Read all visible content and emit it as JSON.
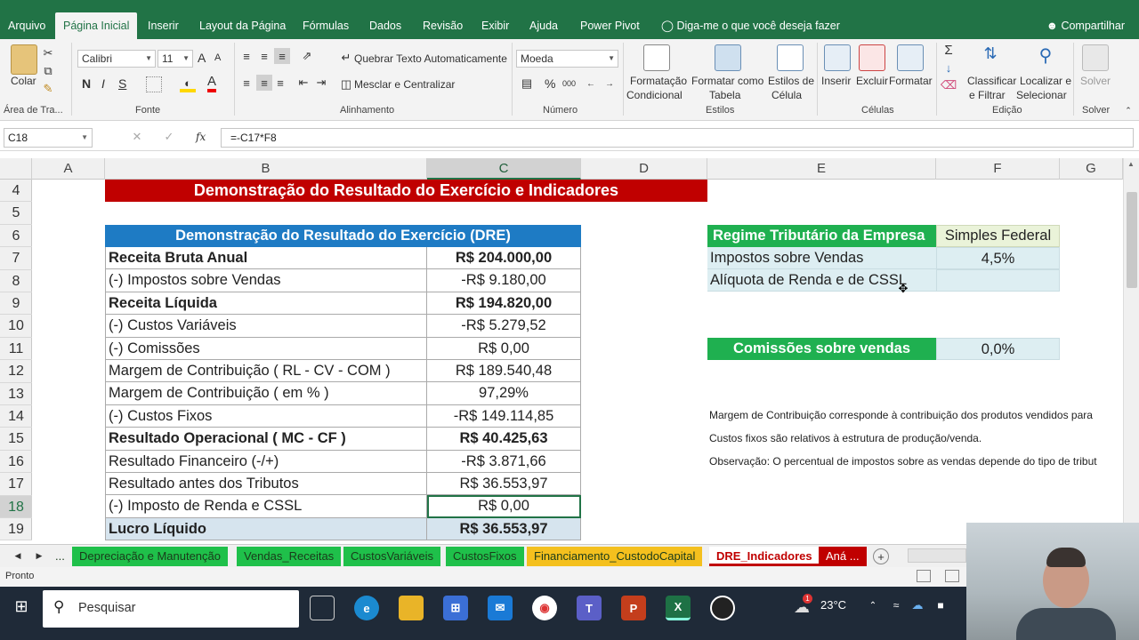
{
  "ribbon_tabs": [
    "Arquivo",
    "Página Inicial",
    "Inserir",
    "Layout da Página",
    "Fórmulas",
    "Dados",
    "Revisão",
    "Exibir",
    "Ajuda",
    "Power Pivot",
    "Diga-me o que você deseja fazer"
  ],
  "share_label": "Compartilhar",
  "ribbon": {
    "clipboard": {
      "paste": "Colar",
      "group": "Área de Tra..."
    },
    "font": {
      "name": "Calibri",
      "size": "11",
      "bold": "N",
      "italic": "I",
      "underline": "S",
      "grow": "A",
      "shrink": "A",
      "color": "A",
      "group": "Fonte"
    },
    "alignment": {
      "wrap": "Quebrar Texto Automaticamente",
      "merge": "Mesclar e Centralizar",
      "group": "Alinhamento"
    },
    "number": {
      "format": "Moeda",
      "percent": "%",
      "thousands": "000",
      "group": "Número"
    },
    "styles": {
      "cond1": "Formatação",
      "cond2": "Condicional",
      "table1": "Formatar como",
      "table2": "Tabela",
      "cell1": "Estilos de",
      "cell2": "Célula",
      "group": "Estilos"
    },
    "cells": {
      "insert": "Inserir",
      "delete": "Excluir",
      "format": "Formatar",
      "group": "Células"
    },
    "editing": {
      "sort1": "Classificar",
      "sort2": "e Filtrar",
      "find1": "Localizar e",
      "find2": "Selecionar",
      "group": "Edição"
    },
    "solver": {
      "label": "Solver",
      "group": "Solver"
    }
  },
  "formula_bar": {
    "name_box": "C18",
    "fx": "fx",
    "formula": "=-C17*F8"
  },
  "columns": [
    "A",
    "B",
    "C",
    "D",
    "E",
    "F",
    "G"
  ],
  "rows": [
    "4",
    "5",
    "6",
    "7",
    "8",
    "9",
    "10",
    "11",
    "12",
    "13",
    "14",
    "15",
    "16",
    "17",
    "18",
    "19"
  ],
  "sheet": {
    "main_title": "Demonstração do Resultado do Exercício e Indicadores",
    "dre_header": "Demonstração do Resultado do Exercício (DRE)",
    "dre_rows": [
      {
        "label": "Receita Bruta Anual",
        "value": "R$ 204.000,00"
      },
      {
        "label": "(-) Impostos sobre Vendas",
        "value": "-R$ 9.180,00"
      },
      {
        "label": "Receita Líquida",
        "value": "R$ 194.820,00"
      },
      {
        "label": "(-) Custos Variáveis",
        "value": "-R$ 5.279,52"
      },
      {
        "label": "(-) Comissões",
        "value": "R$ 0,00"
      },
      {
        "label": "Margem de Contribuição ( RL - CV - COM )",
        "value": "R$ 189.540,48"
      },
      {
        "label": "Margem de Contribuição ( em % )",
        "value": "97,29%"
      },
      {
        "label": "(-) Custos Fixos",
        "value": "-R$ 149.114,85"
      },
      {
        "label": "Resultado Operacional ( MC - CF  )",
        "value": "R$ 40.425,63"
      },
      {
        "label": "Resultado Financeiro (-/+)",
        "value": "-R$ 3.871,66"
      },
      {
        "label": "Resultado antes dos Tributos",
        "value": "R$ 36.553,97"
      },
      {
        "label": "(-) Imposto de Renda e CSSL",
        "value": "R$ 0,00"
      },
      {
        "label": "Lucro Líquido",
        "value": "R$ 36.553,97"
      }
    ],
    "regime_label": "Regime Tributário da Empresa",
    "regime_value": "Simples Federal",
    "impostos_label": "Impostos sobre Vendas",
    "impostos_value": "4,5%",
    "aliquota_label": "Alíquota de Renda e de CSSL",
    "aliquota_value": "",
    "comissoes_label": "Comissões sobre vendas",
    "comissoes_value": "0,0%",
    "note1": "Margem de Contribuição corresponde à contribuição dos produtos vendidos para",
    "note2": "Custos fixos são relativos à estrutura de produção/venda.",
    "note3": "Observação: O percentual de impostos sobre as vendas depende do tipo de tribut"
  },
  "sheet_tabs": [
    "...",
    "Depreciação e Manutenção",
    "Vendas_Receitas",
    "CustosVariáveis",
    "CustosFixos",
    "Financiamento_CustodoCapital",
    "DRE_Indicadores",
    "Aná ..."
  ],
  "status": "Pronto",
  "taskbar": {
    "search": "Pesquisar",
    "weather": "23°C",
    "notif_count": "1"
  },
  "colors": {
    "excel_green": "#217346",
    "title_red": "#c00000",
    "header_blue": "#1e7bc4",
    "label_green": "#1fb050",
    "value_bg": "#ddeef2",
    "total_bg": "#d6e4ee"
  }
}
